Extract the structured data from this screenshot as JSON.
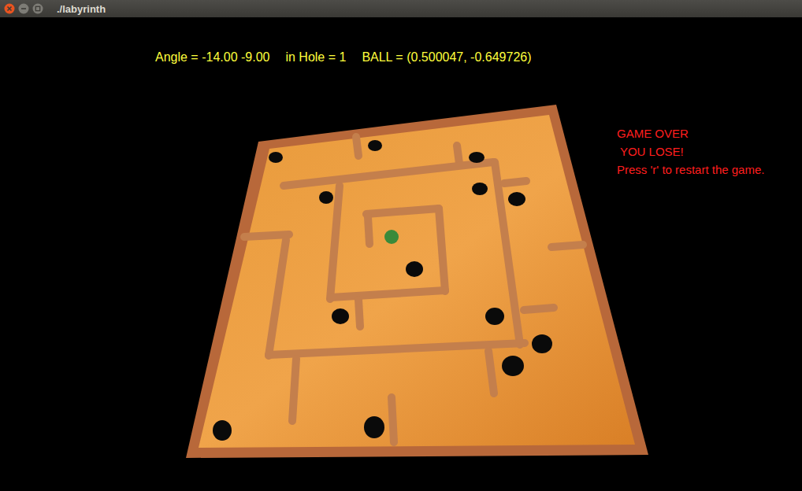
{
  "window": {
    "title": "./labyrinth"
  },
  "hud": [
    {
      "label": "Angle = -14.00 -9.00"
    },
    {
      "label": "in Hole = 1"
    },
    {
      "label": "BALL = (0.500047, -0.649726)"
    }
  ],
  "message": {
    "lines": [
      "GAME OVER",
      " YOU LOSE!",
      "Press 'r' to restart the game."
    ]
  }
}
